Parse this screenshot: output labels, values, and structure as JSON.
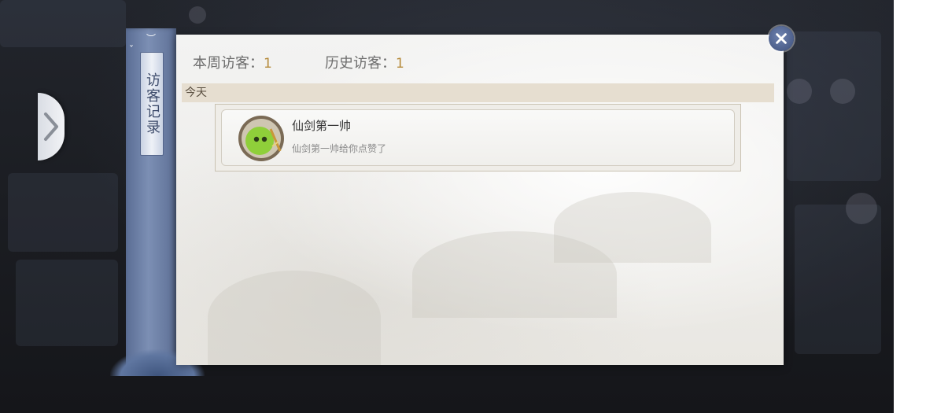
{
  "dialog": {
    "title": "访客记录"
  },
  "stats": {
    "weekly_label": "本周访客：",
    "weekly_count": "1",
    "history_label": "历史访客：",
    "history_count": "1"
  },
  "sections": [
    {
      "label": "今天",
      "visitors": [
        {
          "name": "仙剑第一帅",
          "message": "仙剑第一帅给你点赞了",
          "avatar_icon": "green-ghost-avatar-icon"
        }
      ]
    }
  ],
  "icons": {
    "close": "close-icon",
    "side_arrow": "chevron-right-icon"
  },
  "colors": {
    "spine": "#6d80a8",
    "count_accent": "#b58a3a",
    "section_header_bg": "#e6ded0"
  }
}
